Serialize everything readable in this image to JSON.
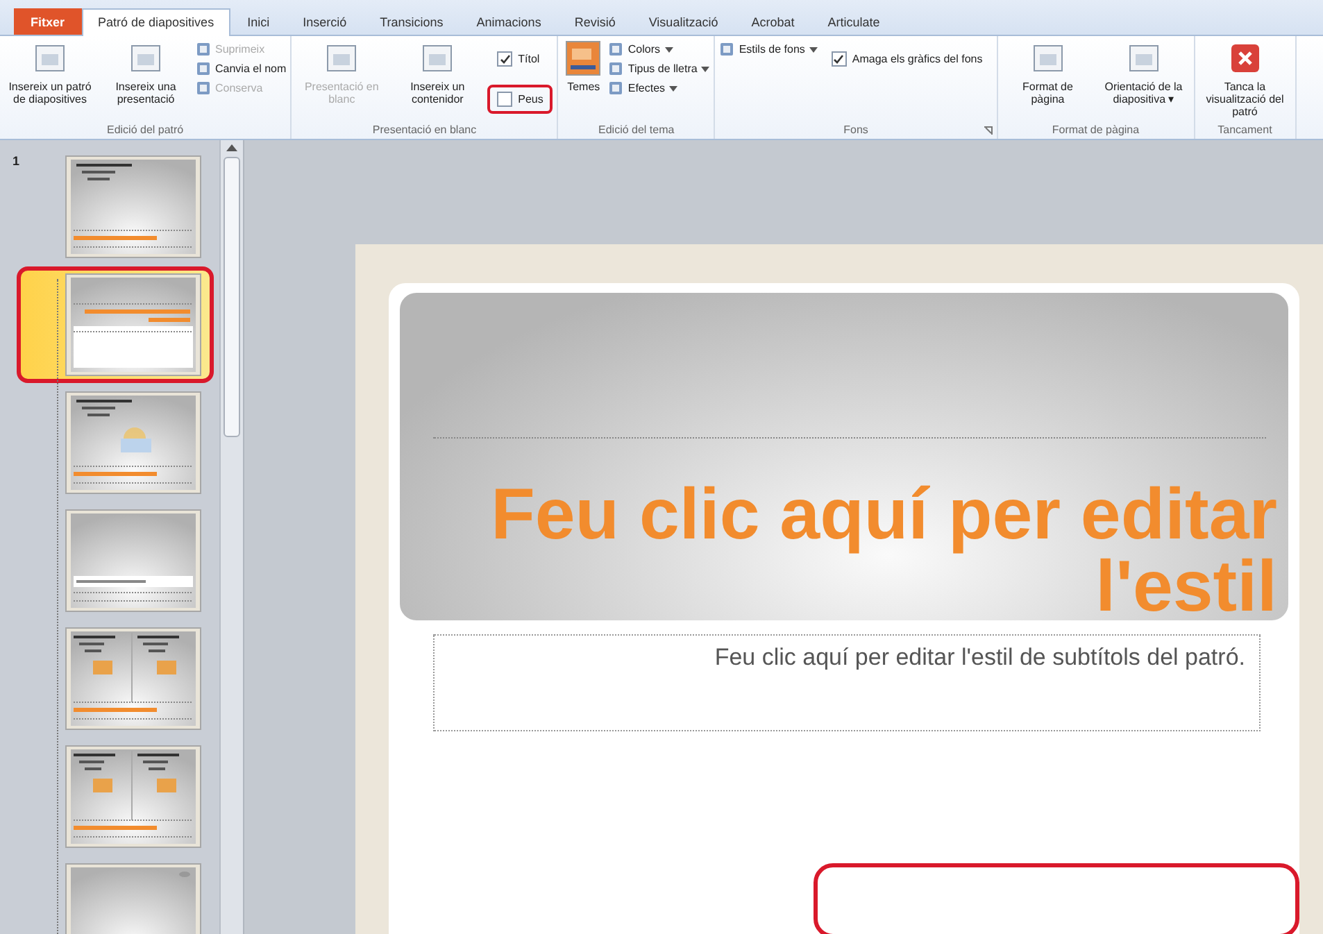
{
  "tabs": [
    {
      "label": "Fitxer",
      "kind": "file",
      "selected": false
    },
    {
      "label": "Patró de diapositives",
      "kind": "tab",
      "selected": true
    },
    {
      "label": "Inici",
      "kind": "tab",
      "selected": false
    },
    {
      "label": "Inserció",
      "kind": "tab",
      "selected": false
    },
    {
      "label": "Transicions",
      "kind": "tab",
      "selected": false
    },
    {
      "label": "Animacions",
      "kind": "tab",
      "selected": false
    },
    {
      "label": "Revisió",
      "kind": "tab",
      "selected": false
    },
    {
      "label": "Visualització",
      "kind": "tab",
      "selected": false
    },
    {
      "label": "Acrobat",
      "kind": "tab",
      "selected": false
    },
    {
      "label": "Articulate",
      "kind": "tab",
      "selected": false
    }
  ],
  "groups": [
    {
      "label": "Edició del patró",
      "items": [
        {
          "kind": "large",
          "label": "Insereix un patró de diapositives",
          "disabled": false
        },
        {
          "kind": "large",
          "label": "Insereix una presentació",
          "disabled": false
        },
        {
          "kind": "stack",
          "items": [
            {
              "label": "Suprimeix",
              "disabled": true,
              "dropdown": false
            },
            {
              "label": "Canvia el nom",
              "disabled": false,
              "dropdown": false
            },
            {
              "label": "Conserva",
              "disabled": true,
              "dropdown": false
            }
          ]
        }
      ]
    },
    {
      "label": "Presentació en blanc",
      "items": [
        {
          "kind": "large",
          "label": "Presentació en blanc",
          "disabled": true
        },
        {
          "kind": "large",
          "label": "Insereix un contenidor",
          "disabled": false
        },
        {
          "kind": "checks",
          "items": [
            {
              "label": "Títol",
              "checked": true,
              "highlighted": false
            },
            {
              "label": "Peus",
              "checked": false,
              "highlighted": true
            }
          ]
        }
      ]
    },
    {
      "label": "Edició del tema",
      "items": [
        {
          "kind": "theme",
          "label": "Temes",
          "disabled": false
        },
        {
          "kind": "stack",
          "items": [
            {
              "label": "Colors",
              "disabled": false,
              "dropdown": true
            },
            {
              "label": "Tipus de lletra",
              "disabled": false,
              "dropdown": true
            },
            {
              "label": "Efectes",
              "disabled": false,
              "dropdown": true
            }
          ]
        }
      ]
    },
    {
      "label": "Fons",
      "launcher": true,
      "items": [
        {
          "kind": "stack",
          "items": [
            {
              "label": "Estils de fons",
              "disabled": false,
              "dropdown": true
            }
          ]
        },
        {
          "kind": "checks",
          "items": [
            {
              "label": "Amaga els gràfics del fons",
              "checked": true,
              "highlighted": false
            }
          ]
        }
      ]
    },
    {
      "label": "Format de pàgina",
      "items": [
        {
          "kind": "large",
          "label": "Format de pàgina",
          "disabled": false
        },
        {
          "kind": "large",
          "label": "Orientació de la diapositiva ▾",
          "disabled": false
        }
      ]
    },
    {
      "label": "Tancament",
      "items": [
        {
          "kind": "close",
          "label": "Tanca la visualització del patró",
          "disabled": false
        }
      ]
    }
  ],
  "thumbnails": {
    "number": "1",
    "slides": [
      {
        "kind": "master",
        "selected": false,
        "highlighted": false
      },
      {
        "kind": "title",
        "selected": true,
        "highlighted": true
      },
      {
        "kind": "content",
        "selected": false,
        "highlighted": false
      },
      {
        "kind": "section",
        "selected": false,
        "highlighted": false
      },
      {
        "kind": "two",
        "selected": false,
        "highlighted": false
      },
      {
        "kind": "two",
        "selected": false,
        "highlighted": false
      },
      {
        "kind": "blank",
        "selected": false,
        "highlighted": false
      }
    ]
  },
  "slide": {
    "title": "Feu clic aquí per editar l'estil",
    "subtitle": "Feu clic aquí per editar l'estil de subtítols del patró.",
    "footer_highlighted": true
  }
}
